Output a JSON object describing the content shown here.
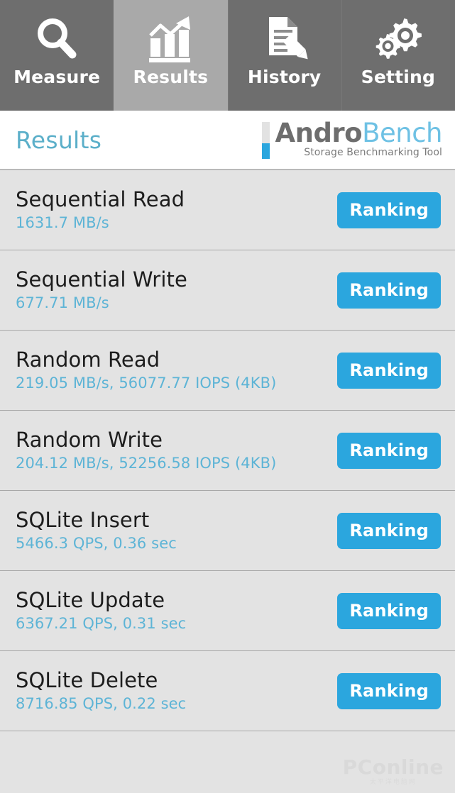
{
  "tabs": [
    {
      "label": "Measure",
      "icon": "magnifier-icon",
      "active": false
    },
    {
      "label": "Results",
      "icon": "bar-chart-icon",
      "active": true
    },
    {
      "label": "History",
      "icon": "document-pencil-icon",
      "active": false
    },
    {
      "label": "Setting",
      "icon": "gears-icon",
      "active": false
    }
  ],
  "header": {
    "title": "Results",
    "brand_first": "Andro",
    "brand_second": "Bench",
    "tagline": "Storage Benchmarking Tool"
  },
  "results": [
    {
      "title": "Sequential Read",
      "value": "1631.7 MB/s",
      "button": "Ranking"
    },
    {
      "title": "Sequential Write",
      "value": "677.71 MB/s",
      "button": "Ranking"
    },
    {
      "title": "Random Read",
      "value": "219.05 MB/s, 56077.77 IOPS (4KB)",
      "button": "Ranking"
    },
    {
      "title": "Random Write",
      "value": "204.12 MB/s, 52256.58 IOPS (4KB)",
      "button": "Ranking"
    },
    {
      "title": "SQLite Insert",
      "value": "5466.3 QPS, 0.36 sec",
      "button": "Ranking"
    },
    {
      "title": "SQLite Update",
      "value": "6367.21 QPS, 0.31 sec",
      "button": "Ranking"
    },
    {
      "title": "SQLite Delete",
      "value": "8716.85 QPS, 0.22 sec",
      "button": "Ranking"
    }
  ],
  "watermark": {
    "name": "PConline",
    "sub": "太平洋电脑网"
  },
  "colors": {
    "tabbar_bg": "#6e6e6e",
    "tab_active_bg": "#a9a9a9",
    "accent_blue": "#2ba6de",
    "value_blue": "#5db4d6",
    "title_blue": "#5bafc9",
    "row_bg": "#e3e3e3",
    "row_divider": "#a8a8a8"
  }
}
